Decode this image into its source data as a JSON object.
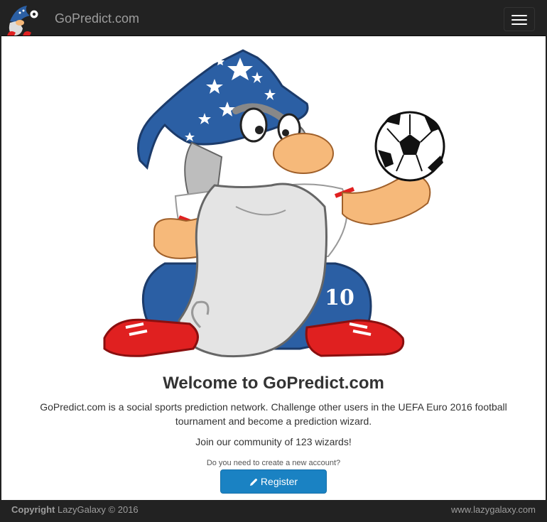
{
  "navbar": {
    "brand": "GoPredict.com",
    "menu_icon": "hamburger-menu-icon"
  },
  "hero": {
    "image": "wizard-mascot-with-football",
    "shirt_number": "10"
  },
  "main": {
    "title": "Welcome to GoPredict.com",
    "intro": "GoPredict.com is a social sports prediction network. Challenge other users in the UEFA Euro 2016 football tournament and become a prediction wizard.",
    "community": "Join our community of 123 wizards!",
    "register_prompt": "Do you need to create a new account?",
    "register_label": "Register",
    "register_icon": "pencil-icon"
  },
  "footer": {
    "copyright_label": "Copyright",
    "copyright_text": "LazyGalaxy © 2016",
    "site_link": "www.lazygalaxy.com"
  },
  "colors": {
    "navbar_bg": "#222222",
    "brand_text": "#9d9d9d",
    "button_blue": "#1a82c3",
    "hat_blue": "#2b5fa4",
    "boot_red": "#e02020"
  }
}
